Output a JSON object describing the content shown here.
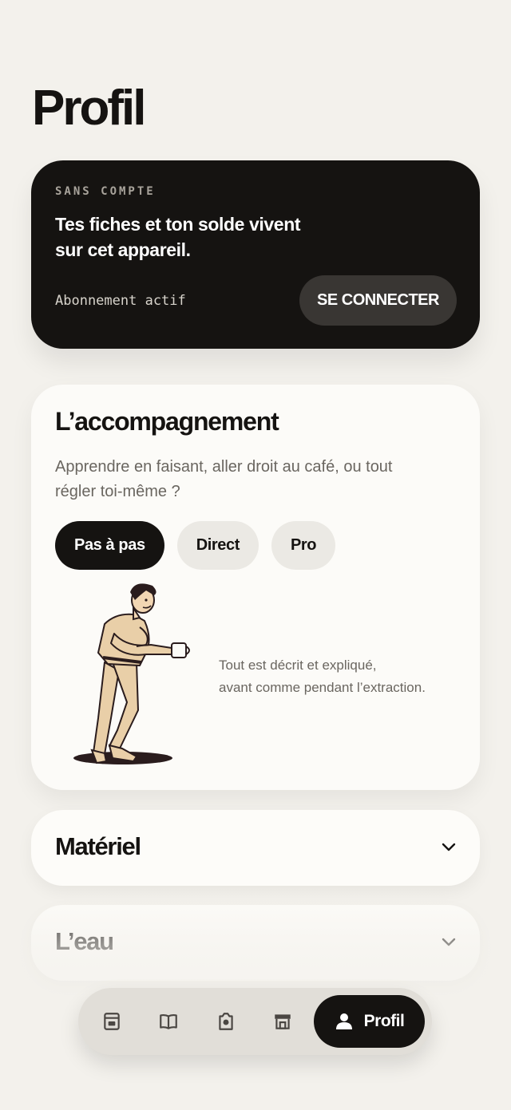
{
  "header": {
    "title": "Profil"
  },
  "account": {
    "eyebrow": "SANS COMPTE",
    "text": "Tes fiches et ton solde vivent sur cet appareil.",
    "status": "Abonnement actif",
    "connect_label": "SE CONNECTER"
  },
  "guide": {
    "title": "L’accompagnement",
    "description": "Apprendre en faisant, aller droit au café, ou tout régler toi-même ?",
    "modes": [
      {
        "label": "Pas à pas",
        "selected": true
      },
      {
        "label": "Direct",
        "selected": false
      },
      {
        "label": "Pro",
        "selected": false
      }
    ],
    "hint_line1": "Tout est décrit et expliqué,",
    "hint_line2": "avant comme pendant l’extraction."
  },
  "sections": [
    {
      "title": "Matériel",
      "icon": "chevron-down-icon"
    },
    {
      "title": "L’eau",
      "icon": "chevron-down-icon"
    }
  ],
  "nav": {
    "items": [
      {
        "icon": "coffee-machine-icon"
      },
      {
        "icon": "book-icon"
      },
      {
        "icon": "camera-icon"
      },
      {
        "icon": "shop-icon"
      }
    ],
    "active_label": "Profil",
    "active_icon": "person-icon"
  },
  "colors": {
    "background": "#f3f1ec",
    "ink": "#151311",
    "card": "#fcfbf8",
    "muted_text": "#6a6660",
    "nav_bg": "#e1ded8"
  }
}
